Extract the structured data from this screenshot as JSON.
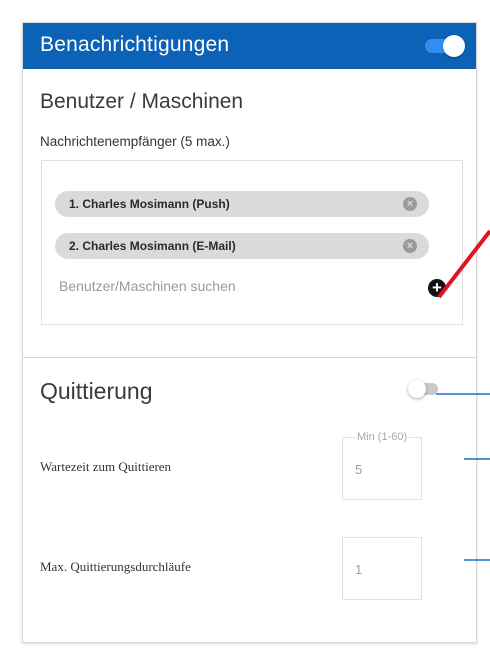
{
  "header": {
    "title": "Benachrichtigungen",
    "toggle_on": true,
    "color": "#0b62b6"
  },
  "users": {
    "title": "Benutzer / Maschinen",
    "subtitle": "Nachrichtenempfänger (5 max.)",
    "recipients": [
      {
        "label": "1. Charles Mosimann  (Push)"
      },
      {
        "label": "2. Charles Mosimann  (E-Mail)"
      }
    ],
    "search_placeholder": "Benutzer/Maschinen suchen",
    "add_icon": "plus-circle-icon"
  },
  "acknowledgement": {
    "title": "Quittierung",
    "toggle_on": false,
    "wait_label": "Wartezeit zum Quittieren",
    "wait_hint": "Min (1-60)",
    "wait_value": "5",
    "max_label": "Max. Quittierungsdurchläufe",
    "max_value": "1"
  },
  "annotation_colors": {
    "red_arrow": "#e0141e",
    "blue_lines": "#1f6fc4"
  }
}
